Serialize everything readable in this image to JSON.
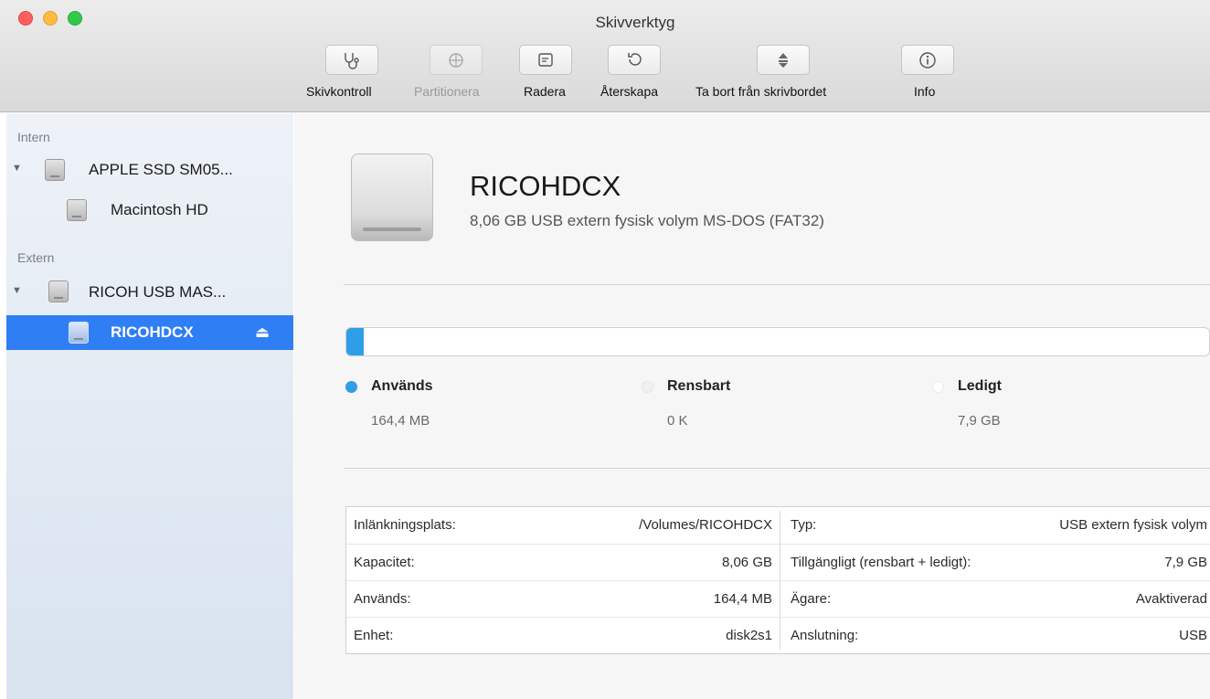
{
  "window": {
    "title": "Skivverktyg"
  },
  "toolbar": {
    "buttons": [
      {
        "label": "Skivkontroll",
        "icon": "stethoscope-icon",
        "enabled": true
      },
      {
        "label": "Partitionera",
        "icon": "partition-pie-icon",
        "enabled": false
      },
      {
        "label": "Radera",
        "icon": "erase-icon",
        "enabled": true
      },
      {
        "label": "Återskapa",
        "icon": "restore-icon",
        "enabled": true
      },
      {
        "label": "Ta bort från skrivbordet",
        "icon": "unmount-icon",
        "enabled": true
      },
      {
        "label": "Info",
        "icon": "info-icon",
        "enabled": true
      }
    ]
  },
  "sidebar": {
    "internal": {
      "header": "Intern",
      "disk": "APPLE SSD SM05...",
      "volume": "Macintosh HD"
    },
    "external": {
      "header": "Extern",
      "disk": "RICOH USB MAS...",
      "volume": "RICOHDCX"
    }
  },
  "volume": {
    "name": "RICOHDCX",
    "description": "8,06 GB USB extern fysisk volym MS-DOS (FAT32)"
  },
  "usage": {
    "used_fraction": 0.02,
    "legend": [
      {
        "title": "Används",
        "value": "164,4 MB",
        "color": "#2f9ee8"
      },
      {
        "title": "Rensbart",
        "value": "0 K",
        "color": "#ffffff"
      },
      {
        "title": "Ledigt",
        "value": "7,9 GB",
        "color": "#ffffff"
      }
    ]
  },
  "info": {
    "left": [
      {
        "key": "Inlänkningsplats:",
        "value": "/Volumes/RICOHDCX"
      },
      {
        "key": "Kapacitet:",
        "value": "8,06 GB"
      },
      {
        "key": "Används:",
        "value": "164,4 MB"
      },
      {
        "key": "Enhet:",
        "value": "disk2s1"
      }
    ],
    "right": [
      {
        "key": "Typ:",
        "value": "USB extern fysisk volym"
      },
      {
        "key": "Tillgängligt (rensbart + ledigt):",
        "value": "7,9 GB"
      },
      {
        "key": "Ägare:",
        "value": "Avaktiverad"
      },
      {
        "key": "Anslutning:",
        "value": "USB"
      }
    ]
  },
  "colors": {
    "accent": "#2f7ef4",
    "used": "#2f9ee8"
  }
}
